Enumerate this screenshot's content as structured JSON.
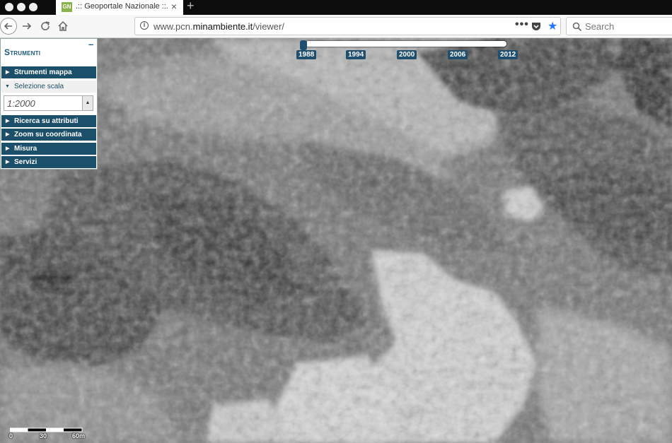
{
  "browser": {
    "tab_title": ".:: Geoportale Nazionale ::.",
    "favicon_text": "GN",
    "tab_close": "×",
    "new_tab": "+",
    "url_prefix": "www.pcn.",
    "url_domain": "minambiente.it",
    "url_path": "/viewer/",
    "more_label": "•••",
    "search_placeholder": "Search",
    "accent_color": "#1f76ff"
  },
  "timeline": {
    "years": [
      "1988",
      "1994",
      "2000",
      "2006",
      "2012"
    ],
    "selected": "1988",
    "track_color": "#ffffff",
    "badge_color": "#1f4e6e"
  },
  "tools": {
    "title": "Strumenti",
    "minimize": "–",
    "items": [
      {
        "label": "Strumenti mappa",
        "expanded": false
      },
      {
        "label": "Selezione scala",
        "expanded": true
      },
      {
        "label": "Ricerca su attributi",
        "expanded": false
      },
      {
        "label": "Zoom su coordinata",
        "expanded": false
      },
      {
        "label": "Misura",
        "expanded": false
      },
      {
        "label": "Servizi",
        "expanded": false
      }
    ],
    "scale_value": "1:2000",
    "panel_color": "#1c4f69"
  },
  "scalebar": {
    "labels": [
      "0",
      "30",
      "60m"
    ]
  }
}
